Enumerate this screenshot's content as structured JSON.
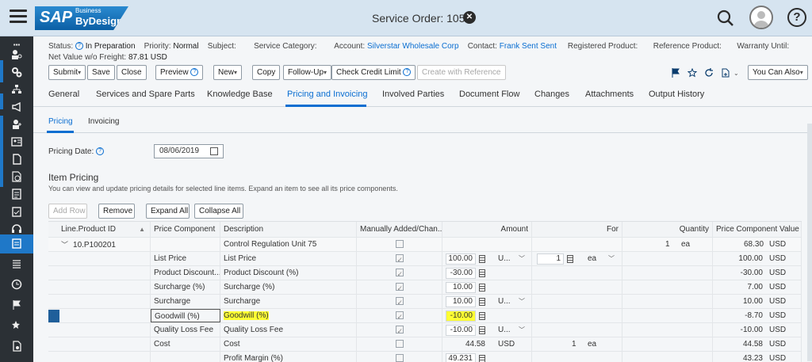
{
  "app": {
    "logo_main": "SAP",
    "logo_business": "Business",
    "logo_product": "ByDesign",
    "title": "Service Order: 1052"
  },
  "header": {
    "status_label": "Status:",
    "status_value": "In Preparation",
    "priority_label": "Priority:",
    "priority_value": "Normal",
    "subject_label": "Subject:",
    "service_category_label": "Service Category:",
    "account_label": "Account:",
    "account_value": "Silverstar Wholesale Corp",
    "contact_label": "Contact:",
    "contact_value": "Frank Sent Sent",
    "registered_product_label": "Registered Product:",
    "reference_product_label": "Reference Product:",
    "warranty_label": "Warranty Until:",
    "net_value_label": "Net Value w/o Freight:",
    "net_value": "87.81 USD"
  },
  "toolbar": {
    "submit": "Submit",
    "save": "Save",
    "close": "Close",
    "preview": "Preview",
    "new": "New",
    "copy": "Copy",
    "follow_up": "Follow-Up",
    "check_credit": "Check Credit Limit",
    "create_ref": "Create with Reference",
    "you_can_also": "You Can Also"
  },
  "tabs": [
    "General",
    "Services and Spare Parts",
    "Knowledge Base",
    "Pricing and Invoicing",
    "Involved Parties",
    "Document Flow",
    "Changes",
    "Attachments",
    "Output History"
  ],
  "subtabs": [
    "Pricing",
    "Invoicing"
  ],
  "pricing": {
    "date_label": "Pricing Date:",
    "date_value": "08/06/2019",
    "section_title": "Item Pricing",
    "section_desc": "You can view and update pricing details for selected line items. Expand an item to see all its price components.",
    "add_row": "Add Row",
    "remove": "Remove",
    "expand_all": "Expand All",
    "collapse_all": "Collapse All"
  },
  "table": {
    "columns": [
      "Line.Product ID",
      "Price Component",
      "Description",
      "Manually Added/Chan...",
      "Amount",
      "For",
      "Quantity",
      "Price Component Value"
    ],
    "parent": {
      "line": "10.P100201",
      "description": "Control Regulation Unit 75",
      "quantity": "1",
      "quantity_unit": "ea",
      "value": "68.30",
      "currency": "USD"
    },
    "rows": [
      {
        "component": "List Price",
        "description": "List Price",
        "checked": true,
        "amount": "100.00",
        "amount_unit": "U...",
        "for": "1",
        "for_unit": "ea",
        "value": "100.00",
        "currency": "USD"
      },
      {
        "component": "Product Discount...",
        "description": "Product Discount (%)",
        "checked": true,
        "amount": "-30.00",
        "amount_unit": "",
        "for": "",
        "for_unit": "",
        "value": "-30.00",
        "currency": "USD"
      },
      {
        "component": "Surcharge (%)",
        "description": "Surcharge (%)",
        "checked": true,
        "amount": "10.00",
        "amount_unit": "",
        "for": "",
        "for_unit": "",
        "value": "7.00",
        "currency": "USD"
      },
      {
        "component": "Surcharge",
        "description": "Surcharge",
        "checked": true,
        "amount": "10.00",
        "amount_unit": "U...",
        "for": "",
        "for_unit": "",
        "value": "10.00",
        "currency": "USD"
      },
      {
        "component": "Goodwill (%)",
        "description": "Goodwill (%)",
        "checked": true,
        "amount": "-10.00",
        "amount_unit": "",
        "for": "",
        "for_unit": "",
        "value": "-8.70",
        "currency": "USD"
      },
      {
        "component": "Quality Loss Fee",
        "description": "Quality Loss Fee",
        "checked": true,
        "amount": "-10.00",
        "amount_unit": "U...",
        "for": "",
        "for_unit": "",
        "value": "-10.00",
        "currency": "USD"
      },
      {
        "component": "Cost",
        "description": "Cost",
        "checked": false,
        "amount": "44.58",
        "amount_unit": "USD",
        "for": "1",
        "for_unit": "ea",
        "value": "44.58",
        "currency": "USD"
      },
      {
        "component": "",
        "description": "Profit Margin (%)",
        "checked": false,
        "amount": "49.231",
        "amount_unit": "",
        "for": "",
        "for_unit": "",
        "value": "43.23",
        "currency": "USD"
      }
    ]
  },
  "colors": {
    "accent": "#0a6ed1",
    "shell": "#d6e4f0",
    "sidebar": "#2b3035",
    "highlight": "#ffff33"
  }
}
